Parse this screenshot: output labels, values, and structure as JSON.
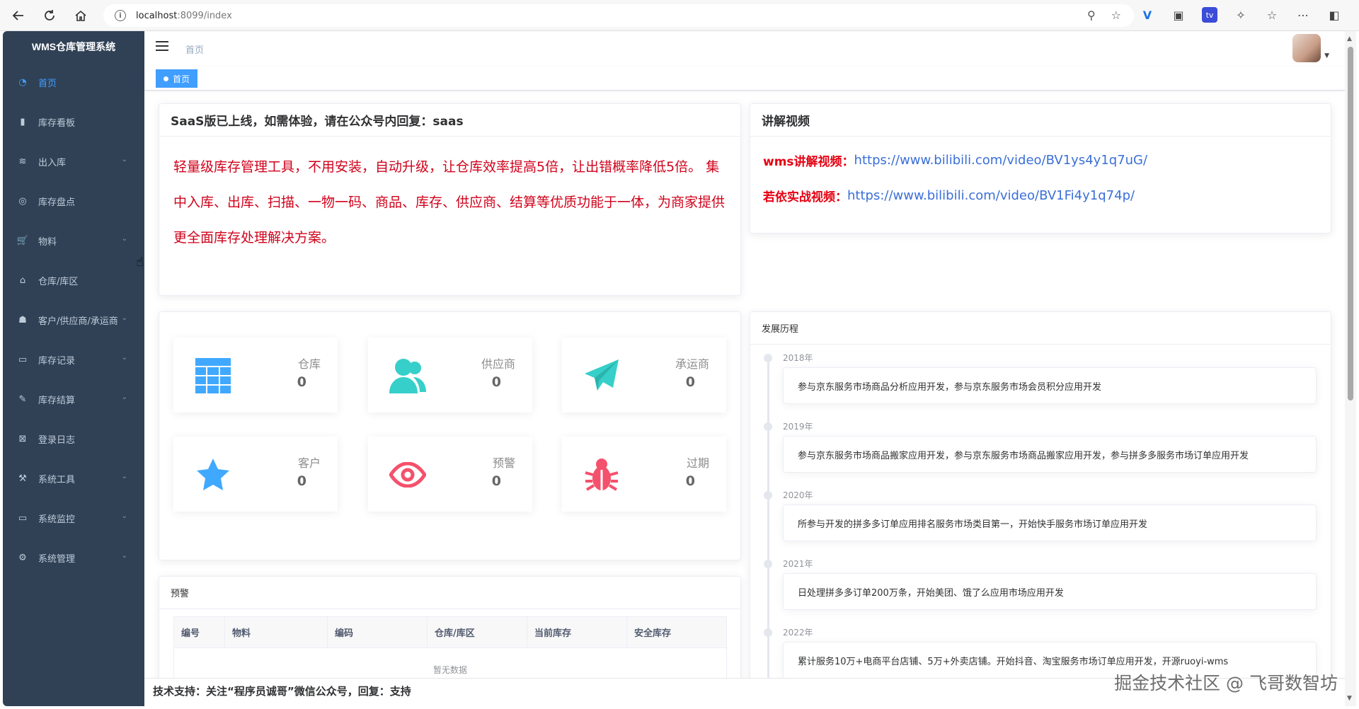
{
  "browser": {
    "url_host": "localhost",
    "url_rest": ":8099/index"
  },
  "sidebar": {
    "title": "WMS仓库管理系统",
    "items": [
      {
        "label": "首页",
        "icon": "dashboard-icon",
        "active": true,
        "has_children": false
      },
      {
        "label": "库存看板",
        "icon": "bar-chart-icon",
        "active": false,
        "has_children": false
      },
      {
        "label": "出入库",
        "icon": "layers-icon",
        "active": false,
        "has_children": true
      },
      {
        "label": "库存盘点",
        "icon": "target-icon",
        "active": false,
        "has_children": false
      },
      {
        "label": "物料",
        "icon": "cart-icon",
        "active": false,
        "has_children": true
      },
      {
        "label": "仓库/库区",
        "icon": "warehouse-icon",
        "active": false,
        "has_children": false
      },
      {
        "label": "客户/供应商/承运商",
        "icon": "people-icon",
        "active": false,
        "has_children": true
      },
      {
        "label": "库存记录",
        "icon": "monitor-icon",
        "active": false,
        "has_children": true
      },
      {
        "label": "库存结算",
        "icon": "edit-icon",
        "active": false,
        "has_children": true
      },
      {
        "label": "登录日志",
        "icon": "log-icon",
        "active": false,
        "has_children": false
      },
      {
        "label": "系统工具",
        "icon": "tool-icon",
        "active": false,
        "has_children": true
      },
      {
        "label": "系统监控",
        "icon": "monitor-icon",
        "active": false,
        "has_children": true
      },
      {
        "label": "系统管理",
        "icon": "gear-icon",
        "active": false,
        "has_children": true
      }
    ]
  },
  "header": {
    "breadcrumb": "首页"
  },
  "tags": {
    "active_tag": "首页"
  },
  "saas_card": {
    "title": "SaaS版已上线，如需体验，请在公众号内回复：saas",
    "body": "轻量级库存管理工具，不用安装，自动升级，让仓库效率提高5倍，让出错概率降低5倍。 集中入库、出库、扫描、一物一码、商品、库存、供应商、结算等优质功能于一体，为商家提供更全面库存处理解决方案。"
  },
  "video_card": {
    "title": "讲解视频",
    "lines": [
      {
        "label": "wms讲解视频：",
        "link": "https://www.bilibili.com/video/BV1ys4y1q7uG/"
      },
      {
        "label": "若依实战视频：",
        "link": "https://www.bilibili.com/video/BV1Fi4y1q74p/"
      }
    ]
  },
  "stats": [
    {
      "label": "仓库",
      "value": "0",
      "icon": "grid-icon",
      "color": "#40a9ff"
    },
    {
      "label": "供应商",
      "value": "0",
      "icon": "users-icon",
      "color": "#36cfc9"
    },
    {
      "label": "承运商",
      "value": "0",
      "icon": "paper-plane-icon",
      "color": "#36cfc9"
    },
    {
      "label": "客户",
      "value": "0",
      "icon": "star-icon",
      "color": "#40a9ff"
    },
    {
      "label": "预警",
      "value": "0",
      "icon": "eye-icon",
      "color": "#f4516c"
    },
    {
      "label": "过期",
      "value": "0",
      "icon": "bug-icon",
      "color": "#f4516c"
    }
  ],
  "warning_card": {
    "title": "预警",
    "columns": [
      "编号",
      "物料",
      "编码",
      "仓库/库区",
      "当前库存",
      "安全库存"
    ],
    "empty_text": "暂无数据"
  },
  "timeline_card": {
    "title": "发展历程",
    "items": [
      {
        "year": "2018年",
        "text": "参与京东服务市场商品分析应用开发，参与京东服务市场会员积分应用开发"
      },
      {
        "year": "2019年",
        "text": "参与京东服务市场商品搬家应用开发，参与京东服务市场商品搬家应用开发，参与拼多多服务市场订单应用开发"
      },
      {
        "year": "2020年",
        "text": "所参与开发的拼多多订单应用排名服务市场类目第一，开始快手服务市场订单应用开发"
      },
      {
        "year": "2021年",
        "text": "日处理拼多多订单200万条，开始美团、饿了么应用市场应用开发"
      },
      {
        "year": "2022年",
        "text": "累计服务10万+电商平台店铺、5万+外卖店铺。开始抖音、淘宝服务市场订单应用开发，开源ruoyi-wms"
      }
    ]
  },
  "footer": {
    "text": "技术支持：关注“程序员诚哥”微信公众号，回复：支持"
  },
  "watermark": "掘金技术社区 @ 飞哥数智坊",
  "colors": {
    "sidebar_bg": "#304156",
    "accent": "#409eff",
    "saas_text": "#d0021b",
    "link": "#3a6fd8"
  }
}
